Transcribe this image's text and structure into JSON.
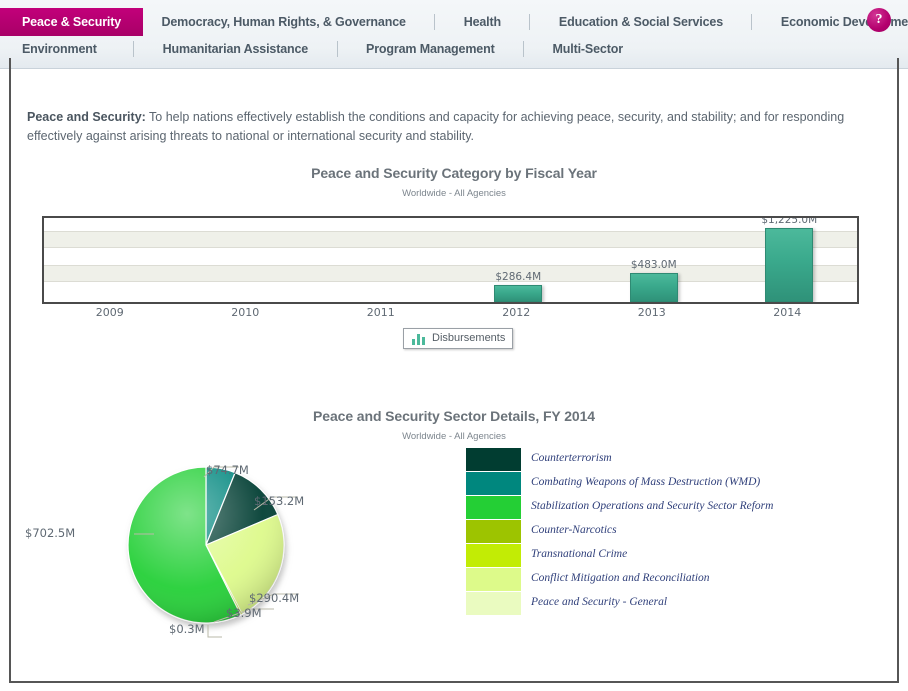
{
  "header": {
    "tabs_row1": [
      {
        "label": "Peace & Security",
        "active": true
      },
      {
        "label": "Democracy, Human Rights, & Governance",
        "active": false
      },
      {
        "label": "Health",
        "active": false
      },
      {
        "label": "Education & Social Services",
        "active": false
      },
      {
        "label": "Economic Development",
        "active": false
      }
    ],
    "tabs_row2": [
      {
        "label": "Environment",
        "active": false
      },
      {
        "label": "Humanitarian Assistance",
        "active": false
      },
      {
        "label": "Program Management",
        "active": false
      },
      {
        "label": "Multi-Sector",
        "active": false
      }
    ],
    "help_label": "?",
    "active_color": "#b4006e"
  },
  "description": {
    "label": "Peace and Security:",
    "text": " To help nations effectively establish the conditions and capacity for achieving peace, security, and stability; and for responding effectively against arising threats to national or international security and stability."
  },
  "legend_button": {
    "label": "Disbursements",
    "icon": "bar-chart-icon"
  },
  "chart_data": [
    {
      "type": "bar",
      "title": "Peace and Security Category by Fiscal Year",
      "subtitle": "Worldwide - All Agencies",
      "xlabel": "",
      "ylabel": "",
      "categories": [
        "2009",
        "2010",
        "2011",
        "2012",
        "2013",
        "2014"
      ],
      "values": [
        0,
        0,
        0,
        286.4,
        483.0,
        1225.0
      ],
      "value_labels": [
        "",
        "",
        "",
        "$286.4M",
        "$483.0M",
        "$1,225.0M"
      ],
      "series": [
        {
          "name": "Disbursements",
          "values": [
            0,
            0,
            0,
            286.4,
            483.0,
            1225.0
          ],
          "color": "#3aa98c"
        }
      ],
      "ylim": [
        0,
        1400
      ],
      "grid": true,
      "units": "USD millions",
      "legend_position": "bottom"
    },
    {
      "type": "pie",
      "title": "Peace and Security Sector Details, FY 2014",
      "subtitle": "Worldwide - All Agencies",
      "labels": [
        "Counterterrorism",
        "Combating Weapons of Mass Destruction (WMD)",
        "Stabilization Operations and Security Sector Reform",
        "Counter-Narcotics",
        "Transnational Crime",
        "Conflict Mitigation and Reconciliation",
        "Peace and Security - General"
      ],
      "values": [
        153.2,
        74.7,
        702.5,
        0.3,
        3.9,
        290.4,
        0.0
      ],
      "value_labels": [
        "$153.2M",
        "$74.7M",
        "$702.5M",
        "$0.3M",
        "$3.9M",
        "$290.4M",
        ""
      ],
      "colors": [
        "#013d31",
        "#00877e",
        "#24cf35",
        "#9dc400",
        "#c2ec05",
        "#ddfa8a",
        "#eafbc0"
      ],
      "units": "USD millions",
      "legend_position": "right"
    }
  ]
}
